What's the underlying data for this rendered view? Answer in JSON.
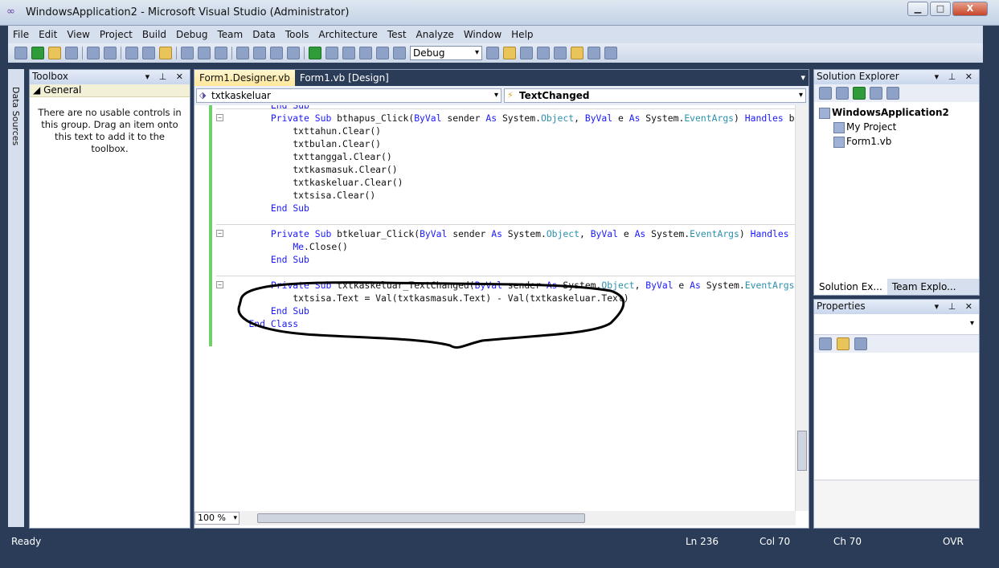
{
  "window": {
    "title": "WindowsApplication2 - Microsoft Visual Studio (Administrator)",
    "min": "▁",
    "max": "□",
    "close": "X"
  },
  "menu": [
    "File",
    "Edit",
    "View",
    "Project",
    "Build",
    "Debug",
    "Team",
    "Data",
    "Tools",
    "Architecture",
    "Test",
    "Analyze",
    "Window",
    "Help"
  ],
  "toolbar": {
    "config": "Debug"
  },
  "side_strip": {
    "label": "Data Sources"
  },
  "toolbox": {
    "title": "Toolbox",
    "group": "General",
    "message": "There are no usable controls in this group. Drag an item onto this text to add it to the toolbox.",
    "header_controls": "▾ ⊥ ✕"
  },
  "editor": {
    "tabs": [
      "Form1.Designer.vb",
      "Form1.vb [Design]"
    ],
    "object_selector": "txtkaskeluar",
    "event_selector": "TextChanged",
    "zoom": "100 %",
    "lines": [
      {
        "indent": 8,
        "text": "End Sub",
        "kind": "kw"
      },
      {
        "indent": 8,
        "text": "Private Sub bthapus_Click(ByVal sender As System.Object, ByVal e As System.EventArgs) Handles btha",
        "kind": "sig",
        "fold": true
      },
      {
        "indent": 12,
        "text": "txttahun.Clear()",
        "kind": "plain"
      },
      {
        "indent": 12,
        "text": "txtbulan.Clear()",
        "kind": "plain"
      },
      {
        "indent": 12,
        "text": "txttanggal.Clear()",
        "kind": "plain"
      },
      {
        "indent": 12,
        "text": "txtkasmasuk.Clear()",
        "kind": "plain"
      },
      {
        "indent": 12,
        "text": "txtkaskeluar.Clear()",
        "kind": "plain"
      },
      {
        "indent": 12,
        "text": "txtsisa.Clear()",
        "kind": "plain"
      },
      {
        "indent": 8,
        "text": "End Sub",
        "kind": "kw"
      },
      {
        "indent": 0,
        "text": "",
        "kind": "blank"
      },
      {
        "indent": 8,
        "text": "Private Sub btkeluar_Click(ByVal sender As System.Object, ByVal e As System.EventArgs) Handles btk",
        "kind": "sig",
        "fold": true
      },
      {
        "indent": 12,
        "text": "Me.Close()",
        "kind": "me"
      },
      {
        "indent": 8,
        "text": "End Sub",
        "kind": "kw"
      },
      {
        "indent": 0,
        "text": "",
        "kind": "blank"
      },
      {
        "indent": 8,
        "text": "Private Sub txtkaskeluar_TextChanged(ByVal sender As System.Object, ByVal e As System.EventArgs) H",
        "kind": "sig",
        "fold": true
      },
      {
        "indent": 12,
        "text": "txtsisa.Text = Val(txtkasmasuk.Text) - Val(txtkaskeluar.Text)",
        "kind": "plain"
      },
      {
        "indent": 8,
        "text": "End Sub",
        "kind": "kw"
      },
      {
        "indent": 4,
        "text": "End Class",
        "kind": "kw"
      }
    ]
  },
  "solution_explorer": {
    "title": "Solution Explorer",
    "header_controls": "▾ ⊥ ✕",
    "items": [
      "WindowsApplication2",
      "My Project",
      "Form1.vb"
    ],
    "bottom_tabs": [
      "Solution Ex...",
      "Team Explo..."
    ]
  },
  "properties": {
    "title": "Properties",
    "header_controls": "▾ ⊥ ✕"
  },
  "status": {
    "ready": "Ready",
    "ln": "Ln 236",
    "col": "Col 70",
    "ch": "Ch 70",
    "ovr": "OVR"
  },
  "colors": {
    "chrome": "#2b3c59",
    "active_tab": "#ffe79a",
    "keyword": "#1a1aff",
    "type": "#2b91af",
    "gutter": "#6fcf6a"
  }
}
